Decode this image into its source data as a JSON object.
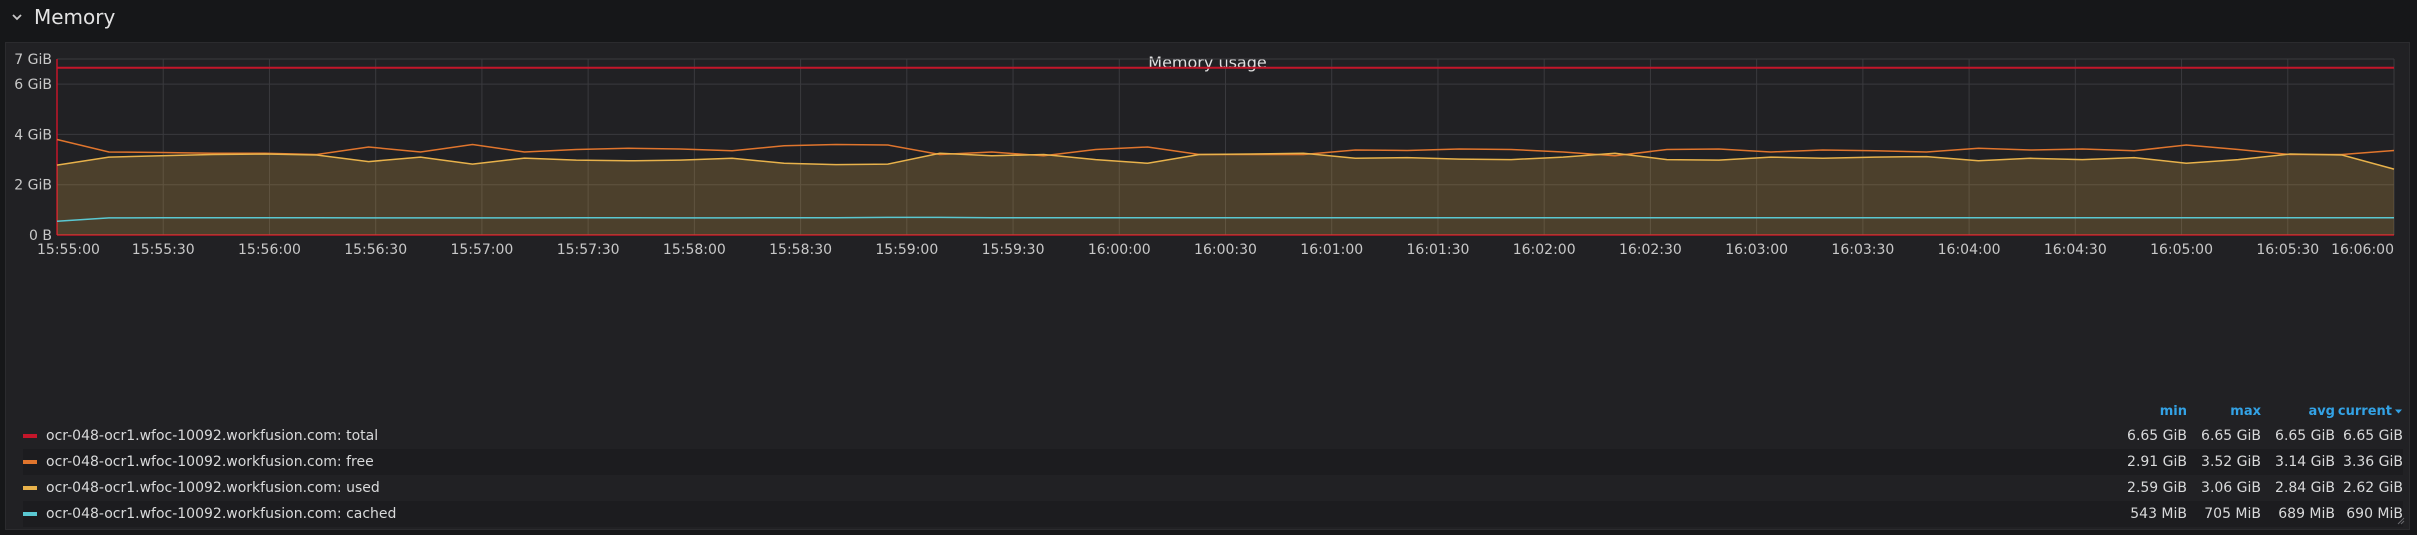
{
  "row": {
    "title": "Memory",
    "chevron_icon": "chevron-down-icon"
  },
  "panel": {
    "title": "Memory usage"
  },
  "colors": {
    "total": "#c4162a",
    "free": "#e0752d",
    "used": "#e8b24b",
    "cached": "#5ac8d2",
    "accent": "#33a2e5"
  },
  "legend": {
    "headers": {
      "min": "min",
      "max": "max",
      "avg": "avg",
      "current": "current"
    },
    "rows": [
      {
        "name": "ocr-048-ocr1.wfoc-10092.workfusion.com: total",
        "min": "6.65 GiB",
        "max": "6.65 GiB",
        "avg": "6.65 GiB",
        "current": "6.65 GiB"
      },
      {
        "name": "ocr-048-ocr1.wfoc-10092.workfusion.com: free",
        "min": "2.91 GiB",
        "max": "3.52 GiB",
        "avg": "3.14 GiB",
        "current": "3.36 GiB"
      },
      {
        "name": "ocr-048-ocr1.wfoc-10092.workfusion.com: used",
        "min": "2.59 GiB",
        "max": "3.06 GiB",
        "avg": "2.84 GiB",
        "current": "2.62 GiB"
      },
      {
        "name": "ocr-048-ocr1.wfoc-10092.workfusion.com: cached",
        "min": "543 MiB",
        "max": "705 MiB",
        "avg": "689 MiB",
        "current": "690 MiB"
      }
    ]
  },
  "chart_data": {
    "type": "area",
    "title": "Memory usage",
    "ylim": [
      0,
      7
    ],
    "yticks": [
      {
        "value": 0,
        "label": "0 B"
      },
      {
        "value": 2,
        "label": "2 GiB"
      },
      {
        "value": 4,
        "label": "4 GiB"
      },
      {
        "value": 6,
        "label": "6 GiB"
      },
      {
        "value": 7,
        "label": "7 GiB"
      }
    ],
    "xticks": [
      "15:55:00",
      "15:55:30",
      "15:56:00",
      "15:56:30",
      "15:57:00",
      "15:57:30",
      "15:58:00",
      "15:58:30",
      "15:59:00",
      "15:59:30",
      "16:00:00",
      "16:00:30",
      "16:01:00",
      "16:01:30",
      "16:02:00",
      "16:02:30",
      "16:03:00",
      "16:03:30",
      "16:04:00",
      "16:04:30",
      "16:05:00",
      "16:05:30",
      "16:06:00"
    ],
    "grid": true,
    "series": [
      {
        "name": "ocr-048-ocr1.wfoc-10092.workfusion.com: total",
        "key": "total",
        "fill": false,
        "values": [
          6.65,
          6.65,
          6.65,
          6.65,
          6.65,
          6.65,
          6.65,
          6.65,
          6.65,
          6.65,
          6.65,
          6.65,
          6.65,
          6.65,
          6.65,
          6.65,
          6.65,
          6.65,
          6.65,
          6.65,
          6.65,
          6.65,
          6.65,
          6.65,
          6.65,
          6.65,
          6.65,
          6.65,
          6.65,
          6.65,
          6.65,
          6.65,
          6.65,
          6.65,
          6.65,
          6.65,
          6.65,
          6.65,
          6.65,
          6.65,
          6.65,
          6.65,
          6.65,
          6.65,
          6.65,
          6.65
        ]
      },
      {
        "name": "ocr-048-ocr1.wfoc-10092.workfusion.com: free",
        "key": "free",
        "fill": false,
        "values": [
          3.8,
          3.3,
          3.28,
          3.25,
          3.25,
          3.2,
          3.5,
          3.3,
          3.6,
          3.3,
          3.4,
          3.45,
          3.42,
          3.35,
          3.55,
          3.6,
          3.58,
          3.2,
          3.3,
          3.15,
          3.4,
          3.5,
          3.2,
          3.2,
          3.2,
          3.38,
          3.36,
          3.42,
          3.4,
          3.3,
          3.15,
          3.4,
          3.42,
          3.3,
          3.38,
          3.35,
          3.3,
          3.45,
          3.38,
          3.42,
          3.35,
          3.58,
          3.4,
          3.2,
          3.2,
          3.36
        ]
      },
      {
        "name": "ocr-048-ocr1.wfoc-10092.workfusion.com: used",
        "key": "used",
        "fill": true,
        "values": [
          2.78,
          3.1,
          3.15,
          3.2,
          3.22,
          3.18,
          2.92,
          3.1,
          2.82,
          3.06,
          2.98,
          2.95,
          2.98,
          3.05,
          2.85,
          2.8,
          2.82,
          3.25,
          3.15,
          3.2,
          3.0,
          2.85,
          3.2,
          3.22,
          3.25,
          3.05,
          3.08,
          3.02,
          3.0,
          3.1,
          3.25,
          3.0,
          2.98,
          3.1,
          3.05,
          3.1,
          3.12,
          2.95,
          3.05,
          3.0,
          3.08,
          2.85,
          3.0,
          3.22,
          3.18,
          2.62
        ]
      },
      {
        "name": "ocr-048-ocr1.wfoc-10092.workfusion.com: cached",
        "key": "cached",
        "fill": false,
        "values": [
          0.55,
          0.68,
          0.69,
          0.69,
          0.69,
          0.69,
          0.68,
          0.68,
          0.68,
          0.68,
          0.69,
          0.69,
          0.68,
          0.68,
          0.69,
          0.69,
          0.7,
          0.7,
          0.69,
          0.69,
          0.69,
          0.69,
          0.69,
          0.69,
          0.69,
          0.69,
          0.69,
          0.69,
          0.69,
          0.69,
          0.69,
          0.69,
          0.69,
          0.69,
          0.69,
          0.69,
          0.69,
          0.69,
          0.69,
          0.69,
          0.69,
          0.69,
          0.69,
          0.69,
          0.69,
          0.69
        ]
      }
    ]
  }
}
